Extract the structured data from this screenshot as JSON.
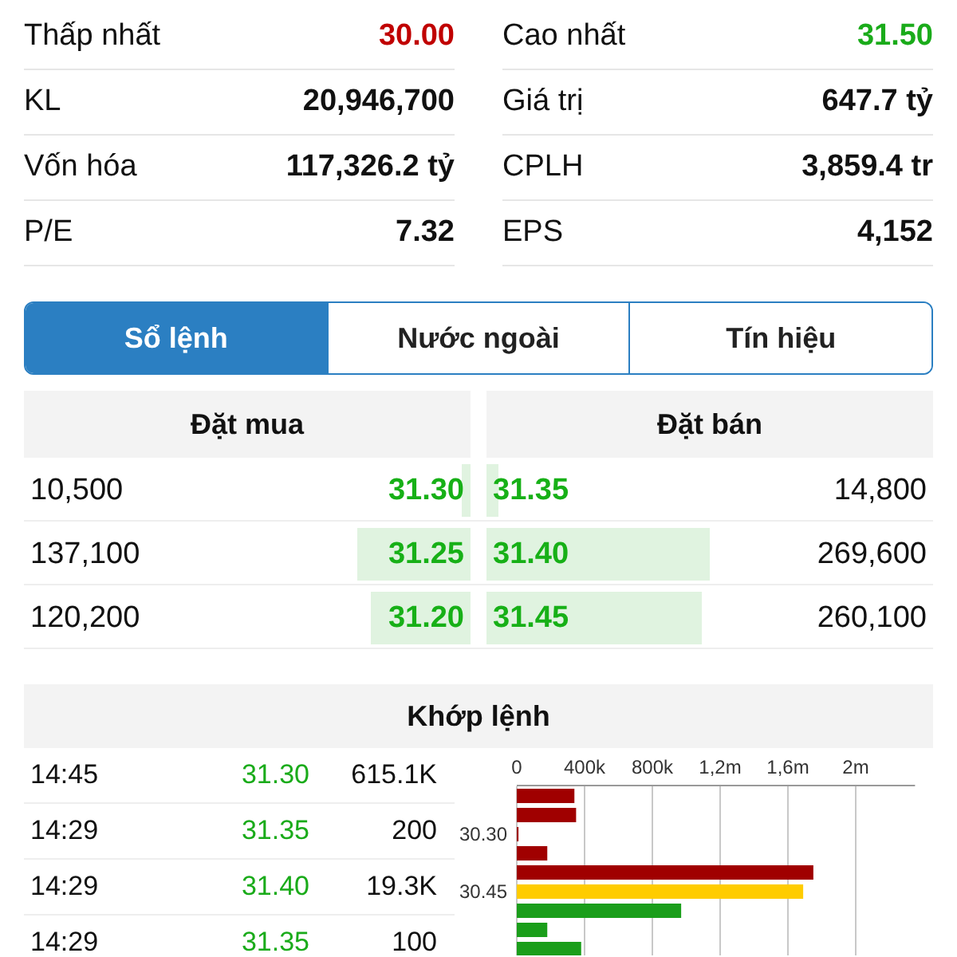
{
  "stats": [
    {
      "left": {
        "label": "Thấp nhất",
        "value": "30.00",
        "color": "#c00000"
      },
      "right": {
        "label": "Cao nhất",
        "value": "31.50",
        "color": "#1aab1a"
      }
    },
    {
      "left": {
        "label": "KL",
        "value": "20,946,700"
      },
      "right": {
        "label": "Giá trị",
        "value": "647.7 tỷ"
      }
    },
    {
      "left": {
        "label": "Vốn hóa",
        "value": "117,326.2 tỷ"
      },
      "right": {
        "label": "CPLH",
        "value": "3,859.4 tr"
      }
    },
    {
      "left": {
        "label": "P/E",
        "value": "7.32"
      },
      "right": {
        "label": "EPS",
        "value": "4,152"
      }
    }
  ],
  "tabs": [
    {
      "label": "Sổ lệnh",
      "selected": true
    },
    {
      "label": "Nước ngoài",
      "selected": false
    },
    {
      "label": "Tín hiệu",
      "selected": false
    }
  ],
  "order_book": {
    "buy_title": "Đặt mua",
    "sell_title": "Đặt bán",
    "rows": [
      {
        "buy": {
          "volume": "10,500",
          "price": "31.30"
        },
        "sell": {
          "price": "31.35",
          "volume": "14,800"
        }
      },
      {
        "buy": {
          "volume": "137,100",
          "price": "31.25"
        },
        "sell": {
          "price": "31.40",
          "volume": "269,600"
        }
      },
      {
        "buy": {
          "volume": "120,200",
          "price": "31.20"
        },
        "sell": {
          "price": "31.45",
          "volume": "260,100"
        }
      }
    ]
  },
  "matches": {
    "title": "Khớp lệnh",
    "rows": [
      {
        "time": "14:45",
        "price": "31.30",
        "volume": "615.1K"
      },
      {
        "time": "14:29",
        "price": "31.35",
        "volume": "200"
      },
      {
        "time": "14:29",
        "price": "31.40",
        "volume": "19.3K"
      },
      {
        "time": "14:29",
        "price": "31.35",
        "volume": "100"
      }
    ],
    "chart_data": {
      "type": "bar",
      "orientation": "horizontal",
      "grid": true,
      "ylim": [
        30.625,
        30.175
      ],
      "x": [
        30.2,
        30.25,
        30.3,
        30.35,
        30.4,
        30.45,
        30.5,
        30.55,
        30.6
      ],
      "series": [
        {
          "color": "#a00000",
          "values": [
            340000,
            350000,
            10000,
            180000,
            1750000,
            null,
            null,
            null,
            null
          ]
        },
        {
          "color": "#ffcc00",
          "values": [
            null,
            null,
            null,
            null,
            null,
            1690000,
            null,
            null,
            null
          ]
        },
        {
          "color": "#1a9e1a",
          "values": [
            null,
            null,
            null,
            null,
            null,
            null,
            970000,
            180000,
            380000
          ]
        }
      ],
      "xlim": [
        0,
        2350000
      ],
      "xticks": [
        {
          "value": 0,
          "label": "0"
        },
        {
          "value": 400000,
          "label": "400k"
        },
        {
          "value": 800000,
          "label": "800k"
        },
        {
          "value": 1200000,
          "label": "1,2m"
        },
        {
          "value": 1600000,
          "label": "1,6m"
        },
        {
          "value": 2000000,
          "label": "2m"
        }
      ],
      "yticks": [
        {
          "value": 30.3,
          "label": "30.30"
        },
        {
          "value": 30.45,
          "label": "30.45"
        }
      ]
    }
  }
}
